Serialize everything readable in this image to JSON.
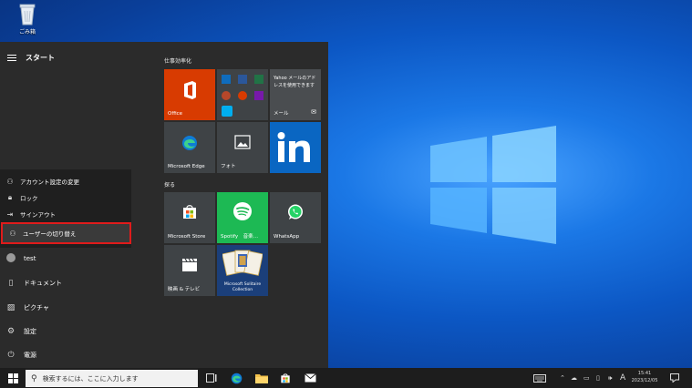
{
  "desktop": {
    "recycle_bin_label": "ごみ箱"
  },
  "start_menu": {
    "title": "スタート",
    "account_menu": [
      {
        "icon": "person-settings-icon",
        "label": "アカウント設定の変更"
      },
      {
        "icon": "lock-icon",
        "label": "ロック"
      },
      {
        "icon": "sign-out-icon",
        "label": "サインアウト"
      },
      {
        "icon": "switch-user-icon",
        "label": "ユーザーの切り替え"
      }
    ],
    "user_name": "test",
    "nav": [
      {
        "icon": "document-icon",
        "label": "ドキュメント"
      },
      {
        "icon": "picture-icon",
        "label": "ピクチャ"
      },
      {
        "icon": "gear-icon",
        "label": "設定"
      },
      {
        "icon": "power-icon",
        "label": "電源"
      }
    ],
    "groups": [
      {
        "label": "仕事効率化"
      },
      {
        "label": "探る"
      }
    ],
    "tiles": {
      "office": "Office",
      "yahoo": "Yahoo メールのアドレスを使用できます",
      "mail": "メール",
      "edge": "Microsoft Edge",
      "photos": "フォト",
      "store": "Microsoft Store",
      "spotify": "Spotify　音楽…",
      "whatsapp": "WhatsApp",
      "movies": "映画 & テレビ",
      "solitaire": "Microsoft Solitaire Collection"
    }
  },
  "taskbar": {
    "search_placeholder": "検索するには、ここに入力します",
    "ime": "A",
    "time": "15:41",
    "date": "2023/12/05"
  },
  "colors": {
    "highlight_border": "#e01b1b",
    "office_tile": "#d83b01",
    "spotify_tile": "#1db954",
    "linkedin_tile": "#0a66c2"
  }
}
